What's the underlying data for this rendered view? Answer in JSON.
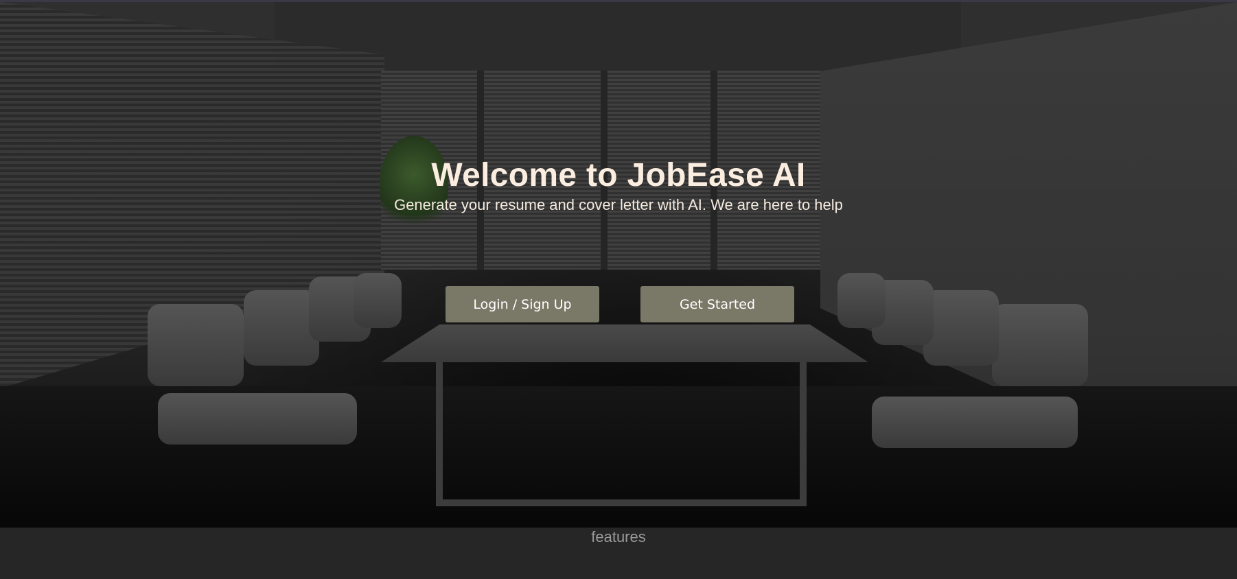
{
  "hero": {
    "title": "Welcome to JobEase AI",
    "subtitle": "Generate your resume and cover letter with AI. We are here to help",
    "background_image": "dark office conference room with table and chairs",
    "buttons": {
      "login_label": "Login / Sign Up",
      "get_started_label": "Get Started"
    }
  },
  "features": {
    "heading": "features"
  },
  "colors": {
    "title_text": "#fbeee1",
    "button_bg": "#7a7968",
    "button_text": "#ffffff",
    "features_bg": "#262626",
    "features_text": "#9a9a9a"
  }
}
